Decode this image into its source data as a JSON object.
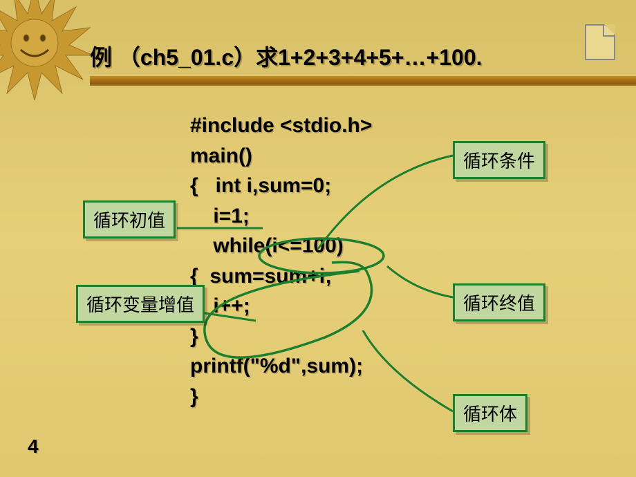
{
  "slide": {
    "title": "例 （ch5_01.c）求1+2+3+4+5+…+100.",
    "page_number": "4"
  },
  "code": {
    "line1": "#include <stdio.h>",
    "line2": "main()",
    "line3": "{   int i,sum=0;",
    "line4": "    i=1;",
    "line5": "    while(i<=100)",
    "line6": "{  sum=sum+i;",
    "line7": "    i++;",
    "line8": "}",
    "line9": "printf(\"%d\",sum);",
    "line10": "}"
  },
  "callouts": {
    "init_value": "循环初值",
    "increment": "循环变量增值",
    "condition": "循环条件",
    "end_value": "循环终值",
    "body": "循环体"
  }
}
